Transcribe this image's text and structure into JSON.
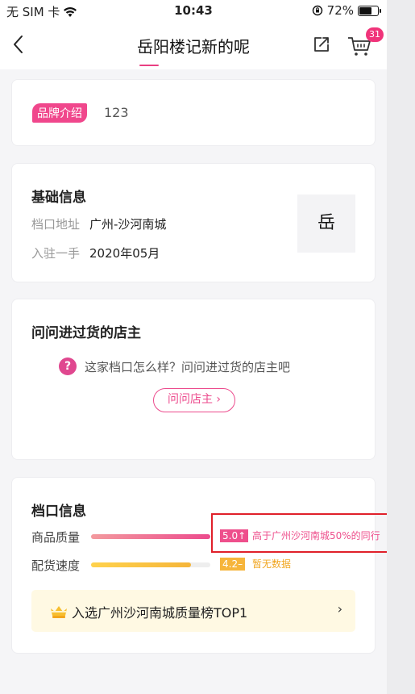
{
  "status": {
    "carrier": "无 SIM 卡",
    "time": "10:43",
    "battery_text": "72%",
    "battery_level": 0.72
  },
  "nav": {
    "title": "岳阳楼记新的呢",
    "cart_count": "31"
  },
  "brand": {
    "tag": "品牌介绍",
    "text": "123"
  },
  "basic_info": {
    "title": "基础信息",
    "rows": [
      {
        "label": "档口地址",
        "value": "广州-沙河南城"
      },
      {
        "label": "入驻一手",
        "value": "2020年05月"
      }
    ],
    "logo_char": "岳"
  },
  "ask": {
    "title": "问问进过货的店主",
    "question_icon": "?",
    "prompt": "这家档口怎么样？问问进过货的店主吧",
    "button_label": "问问店主 ›"
  },
  "stall": {
    "title": "档口信息",
    "metrics": [
      {
        "label": "商品质量",
        "score": "5.0↑",
        "level": 1.0,
        "note": "高于广州沙河南城50%的同行",
        "badge_color": "#ee4f8c",
        "note_color": "#ee4f8c",
        "bar_from": "#f39a9e",
        "bar_to": "#ec4b8d"
      },
      {
        "label": "配货速度",
        "score": "4.2–",
        "level": 0.84,
        "note": "暂无数据",
        "badge_color": "#f6b53b",
        "note_color": "#f0a51f",
        "bar_from": "#ffd24c",
        "bar_to": "#f5b53a"
      }
    ],
    "banner_text": "入选广州沙河南城质量榜TOP1",
    "banner_arrow": "›"
  }
}
